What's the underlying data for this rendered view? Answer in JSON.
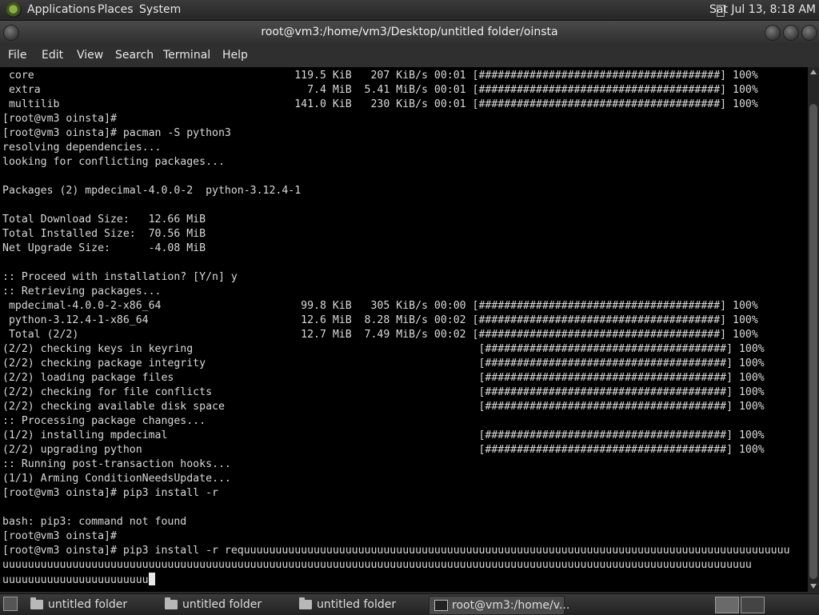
{
  "top_panel": {
    "menus": [
      "Applications",
      "Places",
      "System"
    ],
    "clock": "Sat Jul 13,  8:18 AM"
  },
  "window": {
    "title": "root@vm3:/home/vm3/Desktop/untitled folder/oinsta",
    "menus": [
      "File",
      "Edit",
      "View",
      "Search",
      "Terminal",
      "Help"
    ]
  },
  "terminal": {
    "lines": [
      " core                                         119.5 KiB   207 KiB/s 00:01 [######################################] 100%",
      " extra                                          7.4 MiB  5.41 MiB/s 00:01 [######################################] 100%",
      " multilib                                     141.0 KiB   230 KiB/s 00:01 [######################################] 100%",
      "[root@vm3 oinsta]#",
      "[root@vm3 oinsta]# pacman -S python3",
      "resolving dependencies...",
      "looking for conflicting packages...",
      "",
      "Packages (2) mpdecimal-4.0.0-2  python-3.12.4-1",
      "",
      "Total Download Size:   12.66 MiB",
      "Total Installed Size:  70.56 MiB",
      "Net Upgrade Size:      -4.08 MiB",
      "",
      ":: Proceed with installation? [Y/n] y",
      ":: Retrieving packages...",
      " mpdecimal-4.0.0-2-x86_64                      99.8 KiB   305 KiB/s 00:00 [######################################] 100%",
      " python-3.12.4-1-x86_64                        12.6 MiB  8.28 MiB/s 00:02 [######################################] 100%",
      " Total (2/2)                                   12.7 MiB  7.49 MiB/s 00:02 [######################################] 100%",
      "(2/2) checking keys in keyring                                             [######################################] 100%",
      "(2/2) checking package integrity                                           [######################################] 100%",
      "(2/2) loading package files                                                [######################################] 100%",
      "(2/2) checking for file conflicts                                          [######################################] 100%",
      "(2/2) checking available disk space                                        [######################################] 100%",
      ":: Processing package changes...",
      "(1/2) installing mpdecimal                                                 [######################################] 100%",
      "(2/2) upgrading python                                                     [######################################] 100%",
      ":: Running post-transaction hooks...",
      "(1/1) Arming ConditionNeedsUpdate...",
      "[root@vm3 oinsta]# pip3 install -r",
      "",
      "bash: pip3: command not found",
      "[root@vm3 oinsta]#",
      "[root@vm3 oinsta]# pip3 install -r requuuuuuuuuuuuuuuuuuuuuuuuuuuuuuuuuuuuuuuuuuuuuuuuuuuuuuuuuuuuuuuuuuuuuuuuuuuuuuuuuuuuuu",
      "uuuuuuuuuuuuuuuuuuuuuuuuuuuuuuuuuuuuuuuuuuuuuuuuuuuuuuuuuuuuuuuuuuuuuuuuuuuuuuuuuuuuuuuuuuuuuuuuuuuuuuuuuuuuuuuuuuuuuu",
      "uuuuuuuuuuuuuuuuuuuuuuu"
    ]
  },
  "taskbar": {
    "tasks": [
      "untitled folder",
      "untitled folder",
      "untitled folder",
      "root@vm3:/home/v..."
    ]
  }
}
